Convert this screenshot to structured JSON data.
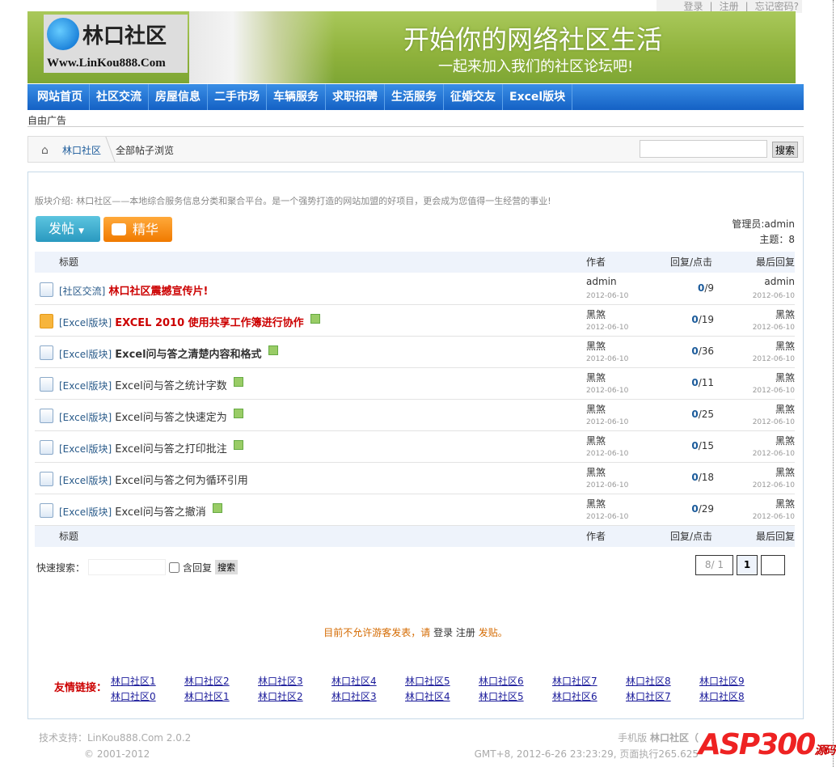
{
  "toplinks": {
    "login": "登录",
    "register": "注册",
    "forgot": "忘记密码?"
  },
  "banner": {
    "logo_name": "林口社区",
    "logo_url": "Www.LinKou888.Com",
    "slogan": "开始你的网络社区生活",
    "subslogan": "一起来加入我们的社区论坛吧!"
  },
  "nav": [
    "网站首页",
    "社区交流",
    "房屋信息",
    "二手市场",
    "车辆服务",
    "求职招聘",
    "生活服务",
    "征婚交友",
    "Excel版块"
  ],
  "ad": "自由广告",
  "breadcrumb": {
    "home": "林口社区",
    "current": "全部帖子浏览",
    "search_button": "搜索"
  },
  "intro": "版块介绍: 林口社区——本地综合服务信息分类和聚合平台。是一个强势打造的网站加盟的好项目，更会成为您值得一生经营的事业!",
  "buttons": {
    "post": "发帖",
    "best": "精华"
  },
  "admin": {
    "moderator": "管理员:admin",
    "topics": "主题：8"
  },
  "columns": {
    "title": "标题",
    "author": "作者",
    "reply": "回复/点击",
    "last": "最后回复"
  },
  "threads": [
    {
      "tag": "[社区交流]",
      "title": "林口社区震撼宣传片!",
      "author": "admin",
      "date": "2012-06-10",
      "replies": "0",
      "views": "/9",
      "last": "admin",
      "last_date": "2012-06-10"
    },
    {
      "tag": "[Excel版块]",
      "title": "EXCEL 2010 使用共享工作簿进行协作",
      "author": "黑煞",
      "date": "2012-06-10",
      "replies": "0",
      "views": "/19",
      "last": "黑煞",
      "last_date": "2012-06-10"
    },
    {
      "tag": "[Excel版块]",
      "title": "Excel问与答之清楚内容和格式",
      "author": "黑煞",
      "date": "2012-06-10",
      "replies": "0",
      "views": "/36",
      "last": "黑煞",
      "last_date": "2012-06-10"
    },
    {
      "tag": "[Excel版块]",
      "title": "Excel问与答之统计字数",
      "author": "黑煞",
      "date": "2012-06-10",
      "replies": "0",
      "views": "/11",
      "last": "黑煞",
      "last_date": "2012-06-10"
    },
    {
      "tag": "[Excel版块]",
      "title": "Excel问与答之快速定为",
      "author": "黑煞",
      "date": "2012-06-10",
      "replies": "0",
      "views": "/25",
      "last": "黑煞",
      "last_date": "2012-06-10"
    },
    {
      "tag": "[Excel版块]",
      "title": "Excel问与答之打印批注",
      "author": "黑煞",
      "date": "2012-06-10",
      "replies": "0",
      "views": "/15",
      "last": "黑煞",
      "last_date": "2012-06-10"
    },
    {
      "tag": "[Excel版块]",
      "title": "Excel问与答之何为循环引用",
      "author": "黑煞",
      "date": "2012-06-10",
      "replies": "0",
      "views": "/18",
      "last": "黑煞",
      "last_date": "2012-06-10"
    },
    {
      "tag": "[Excel版块]",
      "title": "Excel问与答之撤消",
      "author": "黑煞",
      "date": "2012-06-10",
      "replies": "0",
      "views": "/29",
      "last": "黑煞",
      "last_date": "2012-06-10"
    }
  ],
  "quicksearch": {
    "label": "快速搜索：",
    "include_replies": "含回复",
    "button": "搜索"
  },
  "pager": {
    "info": "8/ 1",
    "current": "1"
  },
  "notice": {
    "text": "目前不允许游客发表，请",
    "login": "登录",
    "register": "注册",
    "post": "发贴。"
  },
  "friends": {
    "label": "友情链接：",
    "links": [
      "林口社区1",
      "林口社区2",
      "林口社区3",
      "林口社区4",
      "林口社区5",
      "林口社区6",
      "林口社区7",
      "林口社区8",
      "林口社区9",
      "林口社区0",
      "林口社区1",
      "林口社区2",
      "林口社区3",
      "林口社区4",
      "林口社区5",
      "林口社区6",
      "林口社区7",
      "林口社区8"
    ]
  },
  "footer": {
    "support": "技术支持：LinKou888.Com 2.0.2",
    "copyright": "© 2001-2012",
    "mobile": "手机版",
    "site": "林口社区（",
    "time": "GMT+8, 2012-6-26 23:23:29, 页面执行265.625"
  },
  "watermark": "ASP300源码"
}
